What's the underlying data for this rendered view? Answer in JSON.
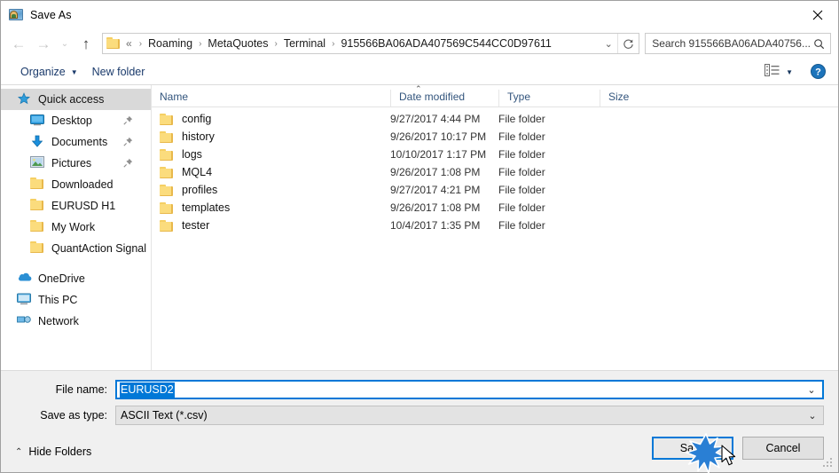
{
  "window": {
    "title": "Save As",
    "icon": "app-icon",
    "close_label": "✕"
  },
  "nav": {
    "back_icon": "←",
    "forward_icon": "→",
    "recent_icon": "⌄",
    "up_icon": "↑",
    "breadcrumb_lead": "«",
    "crumbs": [
      "Roaming",
      "MetaQuotes",
      "Terminal",
      "915566BA06ADA407569C544CC0D97611"
    ],
    "separator": "›",
    "dropdown_caret": "⌄",
    "refresh_icon": "↻"
  },
  "search": {
    "placeholder": "Search 915566BA06ADA40756...",
    "icon": "search-icon"
  },
  "toolbar": {
    "organize_label": "Organize",
    "organize_caret": "▼",
    "new_folder_label": "New folder",
    "view_icon": "list-view-icon",
    "view_caret": "▼",
    "help_icon": "?"
  },
  "sidebar": {
    "items": [
      {
        "label": "Quick access",
        "icon": "star-pin-icon",
        "selected": true,
        "level": 0,
        "pinned": false
      },
      {
        "label": "Desktop",
        "icon": "desktop-icon",
        "selected": false,
        "level": 1,
        "pinned": true
      },
      {
        "label": "Documents",
        "icon": "documents-icon",
        "selected": false,
        "level": 1,
        "pinned": true
      },
      {
        "label": "Pictures",
        "icon": "pictures-icon",
        "selected": false,
        "level": 1,
        "pinned": true
      },
      {
        "label": "Downloaded",
        "icon": "folder-icon",
        "selected": false,
        "level": 1,
        "pinned": false
      },
      {
        "label": "EURUSD H1",
        "icon": "folder-icon",
        "selected": false,
        "level": 1,
        "pinned": false
      },
      {
        "label": "My Work",
        "icon": "folder-icon",
        "selected": false,
        "level": 1,
        "pinned": false
      },
      {
        "label": "QuantAction Signal",
        "icon": "folder-icon",
        "selected": false,
        "level": 1,
        "pinned": false
      }
    ],
    "roots": [
      {
        "label": "OneDrive",
        "icon": "onedrive-icon"
      },
      {
        "label": "This PC",
        "icon": "thispc-icon"
      },
      {
        "label": "Network",
        "icon": "network-icon"
      }
    ]
  },
  "filelist": {
    "columns": [
      "Name",
      "Date modified",
      "Type",
      "Size"
    ],
    "sort_caret": "⌃",
    "rows": [
      {
        "name": "config",
        "date": "9/27/2017 4:44 PM",
        "type": "File folder",
        "size": ""
      },
      {
        "name": "history",
        "date": "9/26/2017 10:17 PM",
        "type": "File folder",
        "size": ""
      },
      {
        "name": "logs",
        "date": "10/10/2017 1:17 PM",
        "type": "File folder",
        "size": ""
      },
      {
        "name": "MQL4",
        "date": "9/26/2017 1:08 PM",
        "type": "File folder",
        "size": ""
      },
      {
        "name": "profiles",
        "date": "9/27/2017 4:21 PM",
        "type": "File folder",
        "size": ""
      },
      {
        "name": "templates",
        "date": "9/26/2017 1:08 PM",
        "type": "File folder",
        "size": ""
      },
      {
        "name": "tester",
        "date": "10/4/2017 1:35 PM",
        "type": "File folder",
        "size": ""
      }
    ]
  },
  "form": {
    "filename_label": "File name:",
    "filename_value": "EURUSD2",
    "filename_selected": true,
    "filetype_label": "Save as type:",
    "filetype_value": "ASCII Text (*.csv)",
    "caret": "⌄"
  },
  "footer": {
    "hide_folders_label": "Hide Folders",
    "hide_folders_caret": "⌃",
    "save_label": "Save",
    "cancel_label": "Cancel"
  },
  "colors": {
    "accent": "#0078d7",
    "selection_bg": "#d9d9d9",
    "folder_yellow": "#fbdc7d",
    "column_header_text": "#33557d",
    "toolbar_link": "#1a3a6b",
    "dialog_bg": "#f0f0f0"
  }
}
